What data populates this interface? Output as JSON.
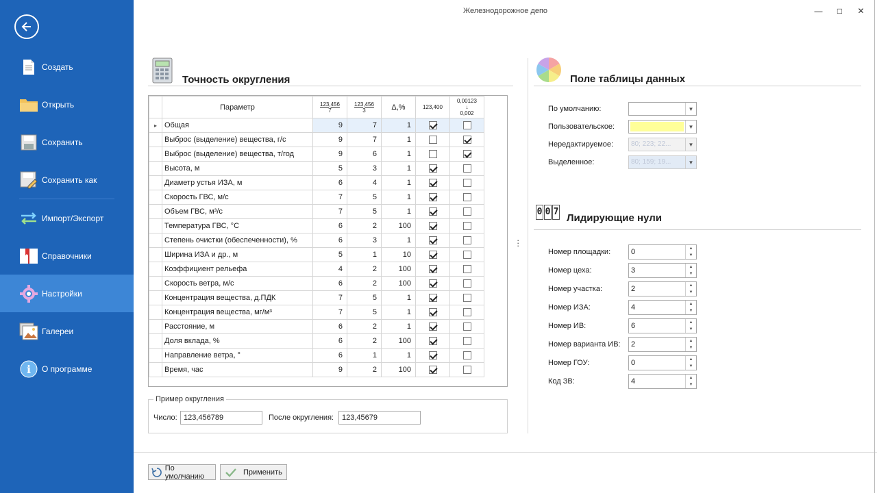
{
  "window": {
    "title": "Железнодорожное депо"
  },
  "sidebar": {
    "items": [
      {
        "label": "Создать",
        "icon": "new-document-icon"
      },
      {
        "label": "Открыть",
        "icon": "folder-icon"
      },
      {
        "label": "Сохранить",
        "icon": "save-icon"
      },
      {
        "label": "Сохранить как",
        "icon": "save-as-icon"
      },
      {
        "label": "Импорт/Экспорт",
        "icon": "import-export-icon"
      },
      {
        "label": "Справочники",
        "icon": "book-icon"
      },
      {
        "label": "Настройки",
        "icon": "gear-icon",
        "active": true
      },
      {
        "label": "Галереи",
        "icon": "gallery-icon"
      },
      {
        "label": "О программе",
        "icon": "info-icon"
      }
    ]
  },
  "rounding": {
    "title": "Точность округления",
    "columns": {
      "param": "Параметр",
      "c1_top": "123,456",
      "c1_bot": "7",
      "c2_top": "123,456",
      "c2_bot": "3",
      "c3": "Δ,%",
      "c4": "123,400",
      "c5_top": "0,00123",
      "c5_bot": "0,002"
    },
    "rows": [
      {
        "name": "Общая",
        "a": "9",
        "b": "7",
        "d": "1",
        "c4": true,
        "c5": false
      },
      {
        "name": "Выброс (выделение) вещества, г/с",
        "a": "9",
        "b": "7",
        "d": "1",
        "c4": false,
        "c5": true
      },
      {
        "name": "Выброс (выделение) вещества, т/год",
        "a": "9",
        "b": "6",
        "d": "1",
        "c4": false,
        "c5": true
      },
      {
        "name": "Высота, м",
        "a": "5",
        "b": "3",
        "d": "1",
        "c4": true,
        "c5": false
      },
      {
        "name": "Диаметр устья ИЗА, м",
        "a": "6",
        "b": "4",
        "d": "1",
        "c4": true,
        "c5": false
      },
      {
        "name": "Скорость ГВС, м/с",
        "a": "7",
        "b": "5",
        "d": "1",
        "c4": true,
        "c5": false
      },
      {
        "name": "Объем ГВС, м³/с",
        "a": "7",
        "b": "5",
        "d": "1",
        "c4": true,
        "c5": false
      },
      {
        "name": "Температура ГВС, °С",
        "a": "6",
        "b": "2",
        "d": "100",
        "c4": true,
        "c5": false
      },
      {
        "name": "Степень очистки (обеспеченности), %",
        "a": "6",
        "b": "3",
        "d": "1",
        "c4": true,
        "c5": false
      },
      {
        "name": "Ширина ИЗА и др., м",
        "a": "5",
        "b": "1",
        "d": "10",
        "c4": true,
        "c5": false
      },
      {
        "name": "Коэффициент рельефа",
        "a": "4",
        "b": "2",
        "d": "100",
        "c4": true,
        "c5": false
      },
      {
        "name": "Скорость ветра, м/с",
        "a": "6",
        "b": "2",
        "d": "100",
        "c4": true,
        "c5": false
      },
      {
        "name": "Концентрация вещества, д.ПДК",
        "a": "7",
        "b": "5",
        "d": "1",
        "c4": true,
        "c5": false
      },
      {
        "name": "Концентрация вещества, мг/м³",
        "a": "7",
        "b": "5",
        "d": "1",
        "c4": true,
        "c5": false
      },
      {
        "name": "Расстояние, м",
        "a": "6",
        "b": "2",
        "d": "1",
        "c4": true,
        "c5": false
      },
      {
        "name": "Доля вклада, %",
        "a": "6",
        "b": "2",
        "d": "100",
        "c4": true,
        "c5": false
      },
      {
        "name": "Направление ветра, °",
        "a": "6",
        "b": "1",
        "d": "1",
        "c4": true,
        "c5": false
      },
      {
        "name": "Время, час",
        "a": "9",
        "b": "2",
        "d": "100",
        "c4": true,
        "c5": false
      }
    ],
    "example": {
      "title": "Пример округления",
      "number_label": "Число:",
      "number_value": "123,456789",
      "after_label": "После округления:",
      "after_value": "123,45679"
    }
  },
  "grid_field": {
    "title": "Поле таблицы данных",
    "default_label": "По умолчанию:",
    "custom_label": "Пользовательское:",
    "readonly_label": "Нередактируемое:",
    "readonly_value": "80; 223; 22...",
    "selected_label": "Выделенное:",
    "selected_value": "80; 159; 19...",
    "custom_color": "#ffff99"
  },
  "leading_zeros": {
    "title": "Лидирующие нули",
    "icon_digits": "007",
    "fields": [
      {
        "label": "Номер площадки:",
        "value": "0"
      },
      {
        "label": "Номер цеха:",
        "value": "3"
      },
      {
        "label": "Номер участка:",
        "value": "2"
      },
      {
        "label": "Номер ИЗА:",
        "value": "4"
      },
      {
        "label": "Номер ИВ:",
        "value": "6"
      },
      {
        "label": "Номер варианта ИВ:",
        "value": "2"
      },
      {
        "label": "Номер ГОУ:",
        "value": "0"
      },
      {
        "label": "Код ЗВ:",
        "value": "4"
      }
    ]
  },
  "footer": {
    "default_button": "По умолчанию",
    "apply_button": "Применить"
  }
}
